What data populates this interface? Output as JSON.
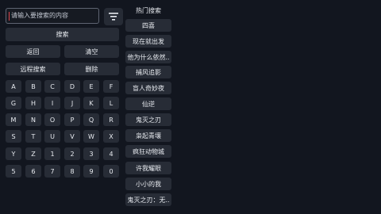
{
  "search": {
    "placeholder": "请输入要搜索的内容",
    "filter_icon": "filter-icon"
  },
  "buttons": {
    "search": "搜索",
    "back": "返回",
    "clear": "清空",
    "remote_search": "远程搜索",
    "delete": "删除"
  },
  "keyboard": {
    "rows": [
      [
        "A",
        "B",
        "C",
        "D",
        "E",
        "F"
      ],
      [
        "G",
        "H",
        "I",
        "J",
        "K",
        "L"
      ],
      [
        "M",
        "N",
        "O",
        "P",
        "Q",
        "R"
      ],
      [
        "S",
        "T",
        "U",
        "V",
        "W",
        "X"
      ],
      [
        "Y",
        "Z",
        "1",
        "2",
        "3",
        "4"
      ],
      [
        "5",
        "6",
        "7",
        "8",
        "9",
        "0"
      ]
    ]
  },
  "hot": {
    "title": "热门搜索",
    "items": [
      "四喜",
      "现在就出发",
      "他为什么依然..",
      "捕风追影",
      "盲人奇妙夜",
      "仙逆",
      "鬼灭之刃",
      "枭起青壤",
      "疯狂动物城",
      "许我耀眼",
      "小小的我",
      "鬼灭之刃：无.."
    ]
  }
}
